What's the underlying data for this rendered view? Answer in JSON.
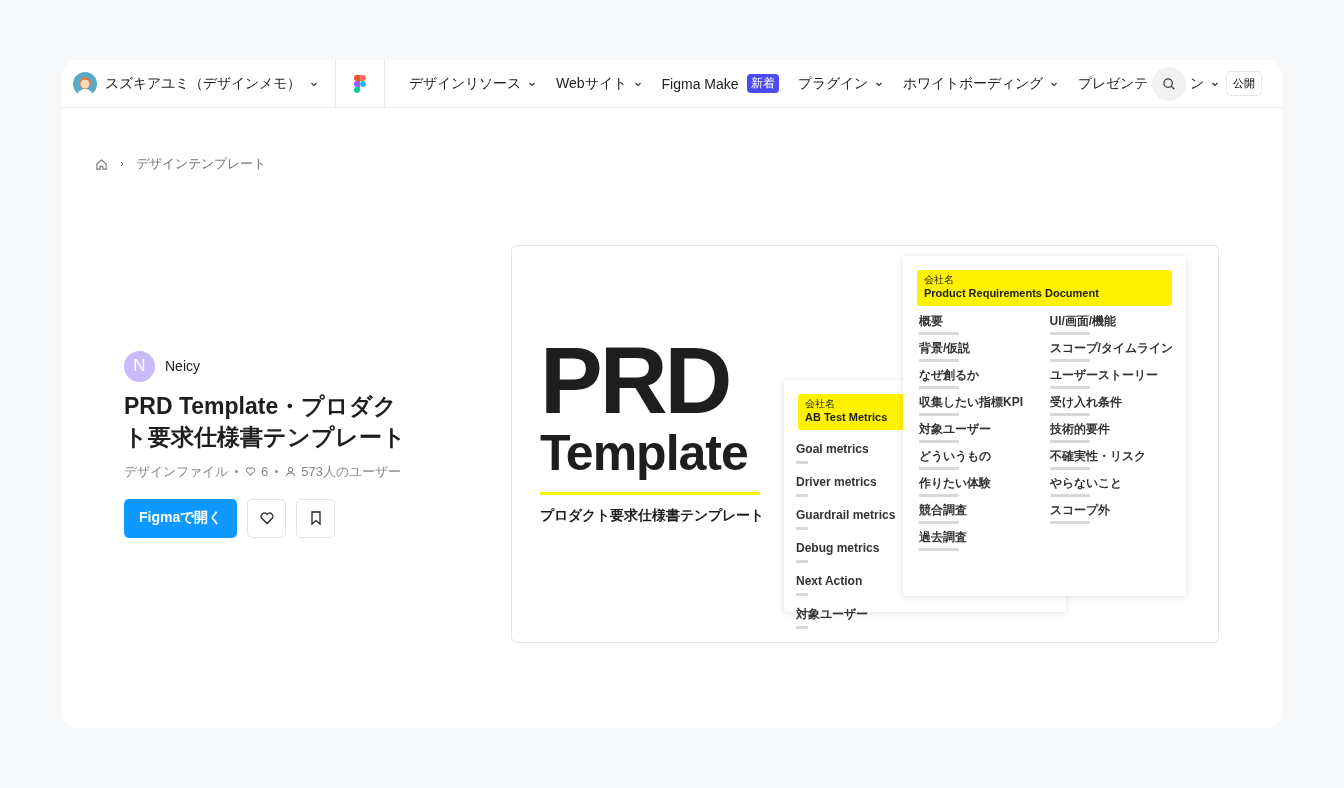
{
  "account": {
    "name": "スズキアユミ（デザインメモ）"
  },
  "nav": [
    {
      "label": "デザインリソース",
      "dropdown": true
    },
    {
      "label": "Webサイト",
      "dropdown": true
    },
    {
      "label": "Figma Make",
      "dropdown": false,
      "badge": "新着"
    },
    {
      "label": "プラグイン",
      "dropdown": true
    },
    {
      "label": "ホワイトボーディング",
      "dropdown": true
    },
    {
      "label": "プレゼンテ",
      "tail": "ン",
      "dropdown": true
    }
  ],
  "publish_button": "公開",
  "breadcrumb": [
    "デザインテンプレート"
  ],
  "author": {
    "initial": "N",
    "name": "Neicy"
  },
  "title": "PRD Template・プロダクト要求仕様書テンプレート",
  "meta": {
    "type": "デザインファイル",
    "likes": "6",
    "users": "573人のユーザー"
  },
  "open_button": "Figmaで開く",
  "preview": {
    "big_title": [
      "PRD",
      "Template"
    ],
    "subtitle": "プロダクト要求仕様書テンプレート",
    "ab_card": {
      "company": "会社名",
      "title": "AB Test Metrics",
      "items": [
        "Goal metrics",
        "Driver metrics",
        "Guardrail metrics",
        "Debug metrics",
        "Next Action",
        "対象ユーザー"
      ]
    },
    "prd_card": {
      "company": "会社名",
      "title": "Product Requirements Document",
      "left": [
        "概要",
        "背景/仮説",
        "なぜ創るか",
        "収集したい指標KPI",
        "対象ユーザー",
        "どういうもの",
        "作りたい体験",
        "競合調査",
        "過去調査"
      ],
      "right": [
        "UI/画面/機能",
        "スコープ/タイムライン",
        "ユーザーストーリー",
        "受け入れ条件",
        "技術的要件",
        "不確実性・リスク",
        "やらないこと",
        "スコープ外"
      ]
    }
  }
}
